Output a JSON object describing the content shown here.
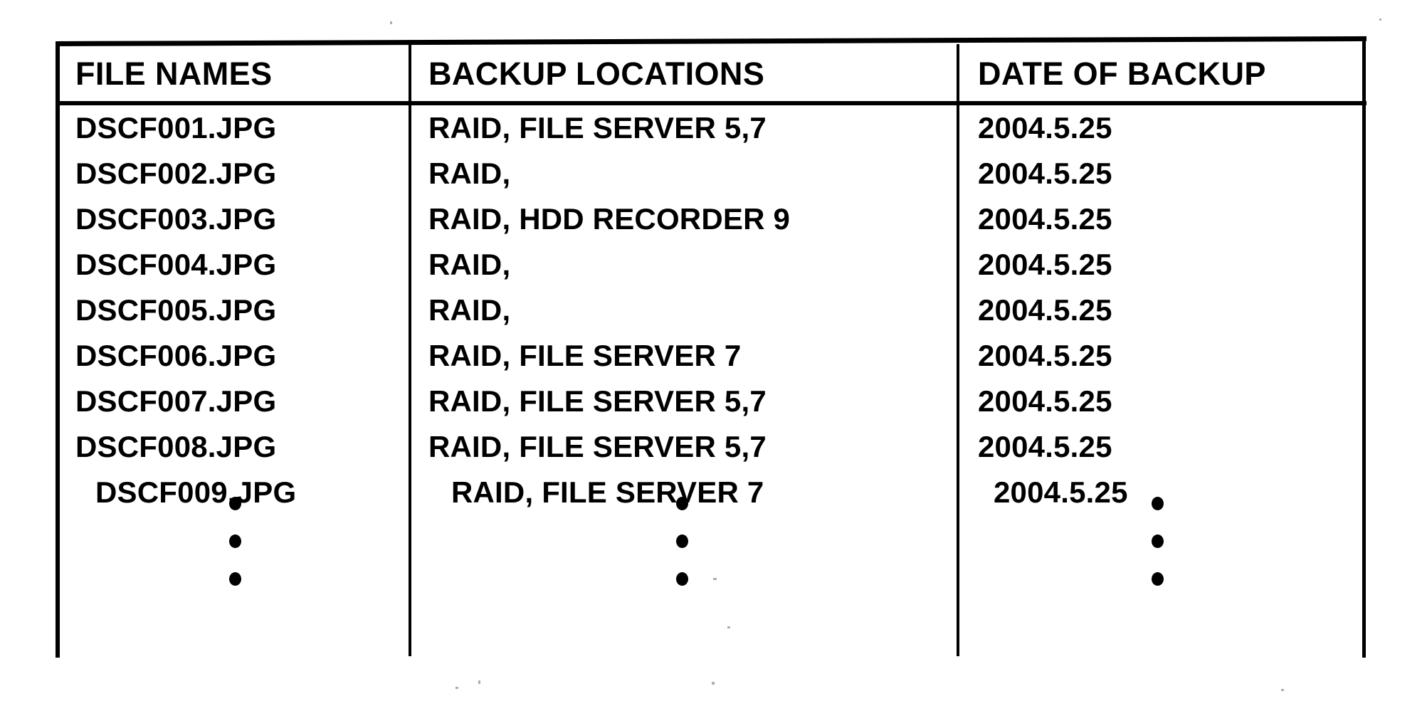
{
  "figure": {
    "type": "table",
    "columns": [
      {
        "key": "file_name",
        "header": "FILE NAMES"
      },
      {
        "key": "backup_location",
        "header": "BACKUP LOCATIONS"
      },
      {
        "key": "date_of_backup",
        "header": "DATE OF BACKUP"
      }
    ],
    "rows": [
      {
        "file_name": "DSCF001.JPG",
        "backup_location": "RAID, FILE SERVER 5,7",
        "date_of_backup": "2004.5.25"
      },
      {
        "file_name": "DSCF002.JPG",
        "backup_location": "RAID,",
        "date_of_backup": "2004.5.25"
      },
      {
        "file_name": "DSCF003.JPG",
        "backup_location": "RAID, HDD RECORDER 9",
        "date_of_backup": "2004.5.25"
      },
      {
        "file_name": "DSCF004.JPG",
        "backup_location": "RAID,",
        "date_of_backup": "2004.5.25"
      },
      {
        "file_name": "DSCF005.JPG",
        "backup_location": "RAID,",
        "date_of_backup": "2004.5.25"
      },
      {
        "file_name": "DSCF006.JPG",
        "backup_location": "RAID, FILE SERVER 7",
        "date_of_backup": "2004.5.25"
      },
      {
        "file_name": "DSCF007.JPG",
        "backup_location": "RAID, FILE SERVER 5,7",
        "date_of_backup": "2004.5.25"
      },
      {
        "file_name": "DSCF008.JPG",
        "backup_location": "RAID, FILE SERVER 5,7",
        "date_of_backup": "2004.5.25"
      },
      {
        "file_name": "DSCF009.JPG",
        "backup_location": "RAID, FILE SERVER 7",
        "date_of_backup": "2004.5.25"
      }
    ],
    "continuation": {
      "symbol": "vertical-ellipsis",
      "dot_count": 3,
      "present_in_columns": [
        "file_name",
        "backup_location",
        "date_of_backup"
      ]
    },
    "colors": {
      "ink": "#000000",
      "paper": "#ffffff"
    }
  }
}
